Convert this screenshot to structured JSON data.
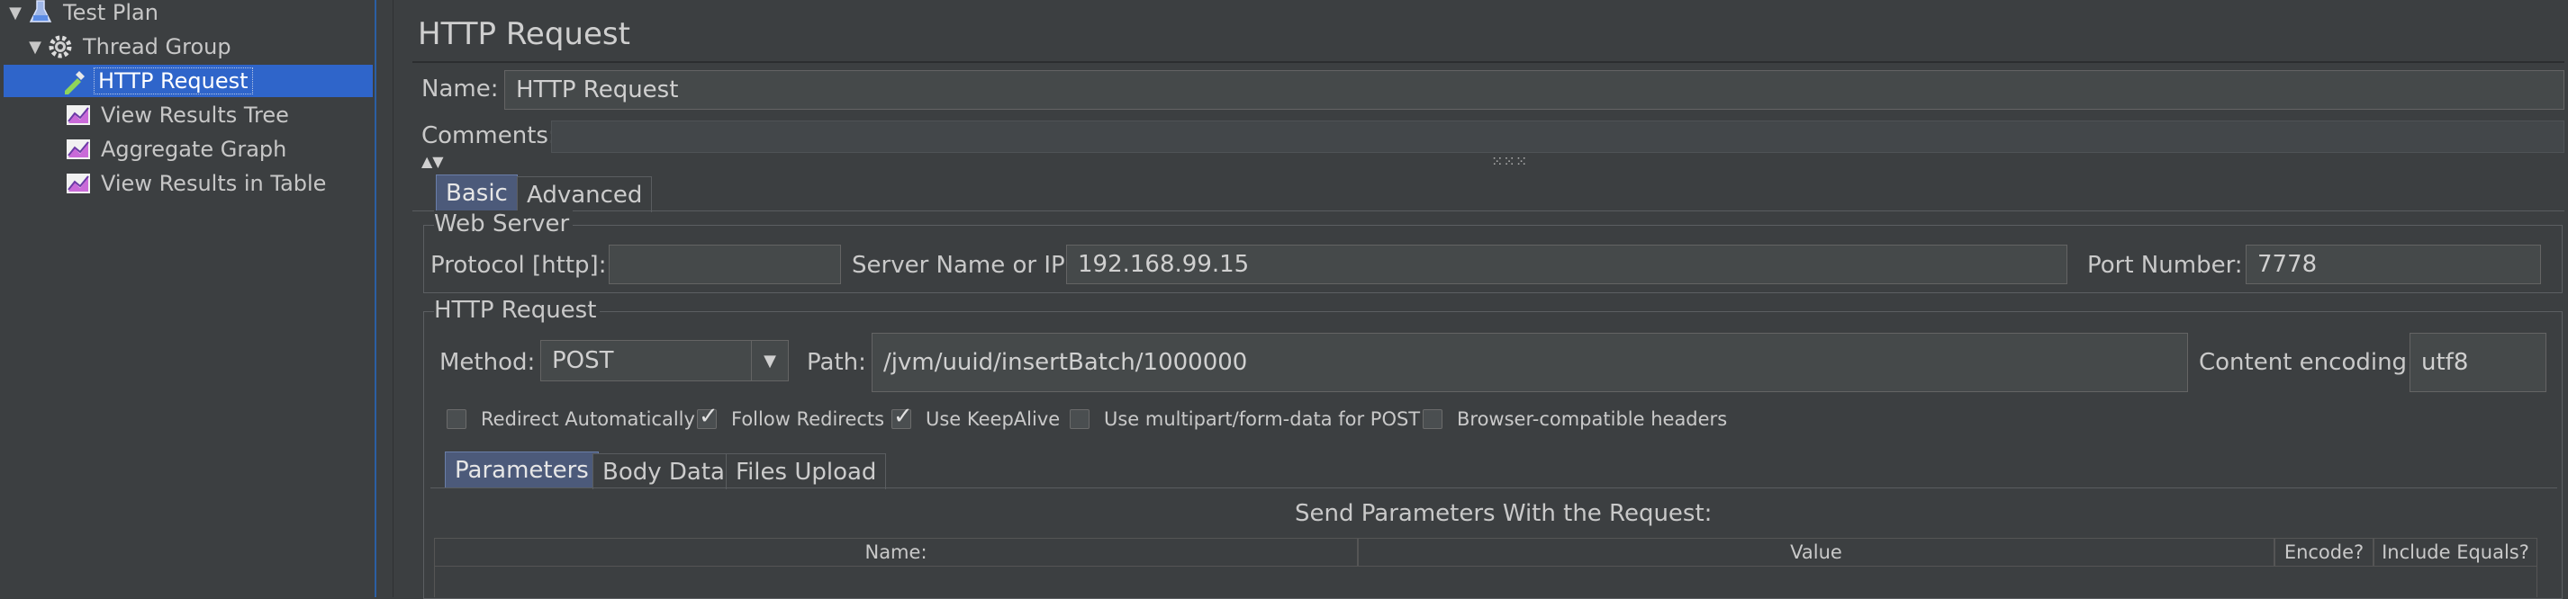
{
  "tree": {
    "items": [
      {
        "label": "Test Plan",
        "icon": "flask-icon"
      },
      {
        "label": "Thread Group",
        "icon": "gear-icon"
      },
      {
        "label": "HTTP Request",
        "icon": "pipette-icon"
      },
      {
        "label": "View Results Tree",
        "icon": "graph-icon"
      },
      {
        "label": "Aggregate Graph",
        "icon": "graph-icon"
      },
      {
        "label": "View Results in Table",
        "icon": "graph-icon"
      }
    ]
  },
  "panel": {
    "title": "HTTP Request",
    "name_label": "Name:",
    "name_value": "HTTP Request",
    "comments_label": "Comments:",
    "tabs": {
      "basic": "Basic",
      "advanced": "Advanced"
    },
    "web_server": {
      "title": "Web Server",
      "protocol_label": "Protocol [http]:",
      "protocol_value": "",
      "server_label": "Server Name or IP:",
      "server_value": "192.168.99.15",
      "port_label": "Port Number:",
      "port_value": "7778"
    },
    "http_request": {
      "title": "HTTP Request",
      "method_label": "Method:",
      "method_value": "POST",
      "path_label": "Path:",
      "path_value": "/jvm/uuid/insertBatch/1000000",
      "encoding_label": "Content encoding:",
      "encoding_value": "utf8"
    },
    "checkboxes": [
      {
        "label": "Redirect Automatically",
        "checked": false
      },
      {
        "label": "Follow Redirects",
        "checked": true
      },
      {
        "label": "Use KeepAlive",
        "checked": true
      },
      {
        "label": "Use multipart/form-data for POST",
        "checked": false
      },
      {
        "label": "Browser-compatible headers",
        "checked": false
      }
    ],
    "sub_tabs": {
      "parameters": "Parameters",
      "body_data": "Body Data",
      "files_upload": "Files Upload"
    },
    "params": {
      "heading": "Send Parameters With the Request:",
      "columns": [
        "Name:",
        "Value",
        "Encode?",
        "Include Equals?"
      ]
    }
  },
  "colors": {
    "selection": "#2f65ca",
    "background": "#3c3f41",
    "field": "#45494a"
  }
}
